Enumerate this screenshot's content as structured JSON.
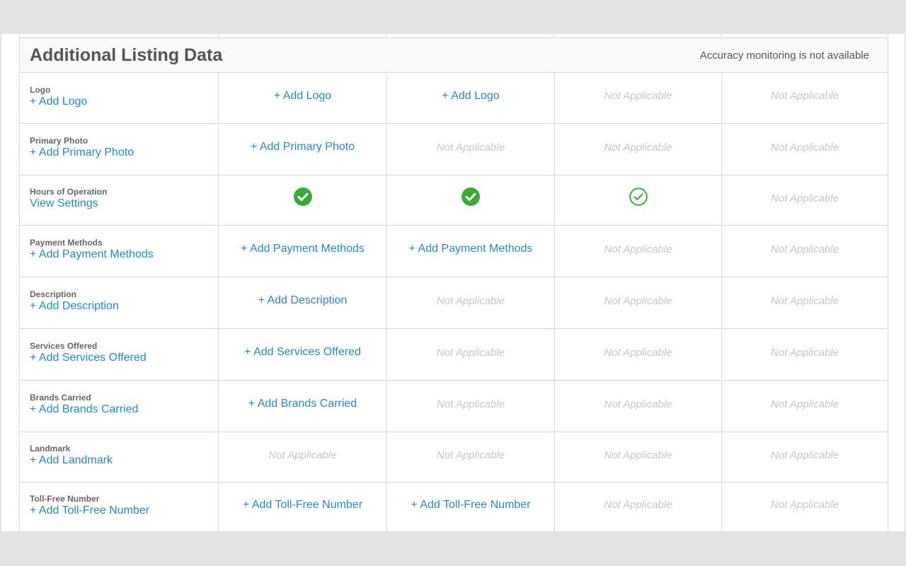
{
  "section": {
    "title": "Additional Listing Data",
    "note": "Accuracy monitoring is not available"
  },
  "colors": {
    "link": "#2a87c8",
    "check_green": "#3aaa35",
    "not_applicable": "#c7c7c7"
  },
  "rows": [
    {
      "label": "Logo",
      "action": "+ Add Logo",
      "cells": [
        {
          "type": "link",
          "text": "+ Add Logo"
        },
        {
          "type": "link",
          "text": "+ Add Logo"
        },
        {
          "type": "na",
          "text": "Not Applicable"
        },
        {
          "type": "na",
          "text": "Not Applicable"
        }
      ]
    },
    {
      "label": "Primary Photo",
      "action": "+ Add Primary Photo",
      "cells": [
        {
          "type": "link",
          "text": "+ Add Primary Photo"
        },
        {
          "type": "na",
          "text": "Not Applicable"
        },
        {
          "type": "na",
          "text": "Not Applicable"
        },
        {
          "type": "na",
          "text": "Not Applicable"
        }
      ]
    },
    {
      "label": "Hours of Operation",
      "action": "View Settings",
      "cells": [
        {
          "type": "check",
          "icon": "check-circle-filled-icon"
        },
        {
          "type": "check",
          "icon": "check-circle-filled-icon"
        },
        {
          "type": "check-outline",
          "icon": "check-circle-outline-icon"
        },
        {
          "type": "na",
          "text": "Not Applicable"
        }
      ]
    },
    {
      "label": "Payment Methods",
      "action": "+ Add Payment Methods",
      "cells": [
        {
          "type": "link",
          "text": "+ Add Payment Methods"
        },
        {
          "type": "link",
          "text": "+ Add Payment Methods"
        },
        {
          "type": "na",
          "text": "Not Applicable"
        },
        {
          "type": "na",
          "text": "Not Applicable"
        }
      ]
    },
    {
      "label": "Description",
      "action": "+ Add Description",
      "cells": [
        {
          "type": "link",
          "text": "+ Add Description"
        },
        {
          "type": "na",
          "text": "Not Applicable"
        },
        {
          "type": "na",
          "text": "Not Applicable"
        },
        {
          "type": "na",
          "text": "Not Applicable"
        }
      ]
    },
    {
      "label": "Services Offered",
      "action": "+ Add Services Offered",
      "cells": [
        {
          "type": "link",
          "text": "+ Add Services Offered"
        },
        {
          "type": "na",
          "text": "Not Applicable"
        },
        {
          "type": "na",
          "text": "Not Applicable"
        },
        {
          "type": "na",
          "text": "Not Applicable"
        }
      ]
    },
    {
      "label": "Brands Carried",
      "action": "+ Add Brands Carried",
      "cells": [
        {
          "type": "link",
          "text": "+ Add Brands Carried"
        },
        {
          "type": "na",
          "text": "Not Applicable"
        },
        {
          "type": "na",
          "text": "Not Applicable"
        },
        {
          "type": "na",
          "text": "Not Applicable"
        }
      ]
    },
    {
      "label": "Landmark",
      "action": "+ Add Landmark",
      "cells": [
        {
          "type": "na",
          "text": "Not Applicable"
        },
        {
          "type": "na",
          "text": "Not Applicable"
        },
        {
          "type": "na",
          "text": "Not Applicable"
        },
        {
          "type": "na",
          "text": "Not Applicable"
        }
      ]
    },
    {
      "label": "Toll-Free Number",
      "action": "+ Add Toll-Free Number",
      "cells": [
        {
          "type": "link",
          "text": "+ Add Toll-Free Number"
        },
        {
          "type": "link",
          "text": "+ Add Toll-Free Number"
        },
        {
          "type": "na",
          "text": "Not Applicable"
        },
        {
          "type": "na",
          "text": "Not Applicable"
        }
      ]
    }
  ]
}
